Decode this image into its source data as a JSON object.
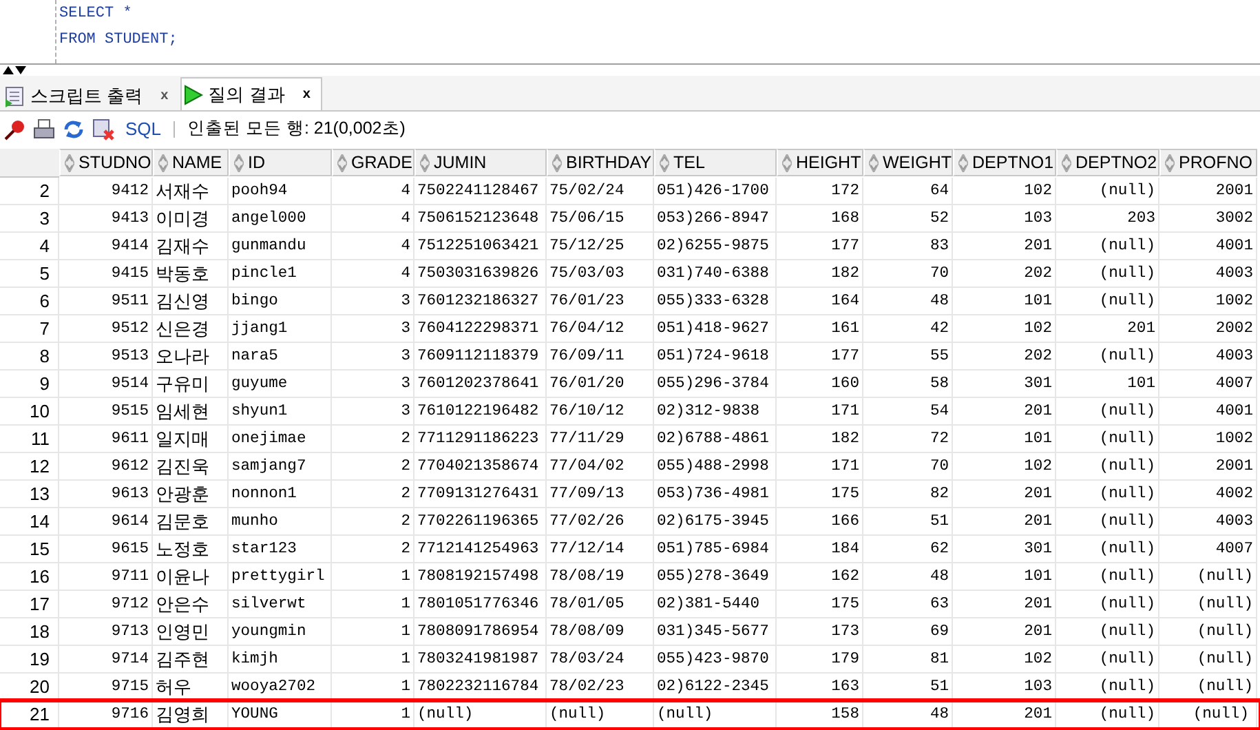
{
  "editor": {
    "lines": [
      "SELECT *",
      "FROM STUDENT;"
    ]
  },
  "tabs": [
    {
      "label": "스크립트 출력",
      "close": "x",
      "selected": false
    },
    {
      "label": "질의 결과",
      "close": "x",
      "selected": true
    }
  ],
  "toolbar": {
    "sql_link": "SQL",
    "status": "인출된 모든 행: 21(0,002초)"
  },
  "table": {
    "columns": [
      {
        "label": "STUDNO",
        "kind": "number"
      },
      {
        "label": "NAME",
        "kind": "hangul"
      },
      {
        "label": "ID",
        "kind": "text"
      },
      {
        "label": "GRADE",
        "kind": "number"
      },
      {
        "label": "JUMIN",
        "kind": "text"
      },
      {
        "label": "BIRTHDAY",
        "kind": "text"
      },
      {
        "label": "TEL",
        "kind": "text"
      },
      {
        "label": "HEIGHT",
        "kind": "number"
      },
      {
        "label": "WEIGHT",
        "kind": "number"
      },
      {
        "label": "DEPTNO1",
        "kind": "number"
      },
      {
        "label": "DEPTNO2",
        "kind": "number"
      },
      {
        "label": "PROFNO",
        "kind": "number"
      }
    ],
    "rows": [
      {
        "number": "2",
        "highlighted": false,
        "cells": [
          "9412",
          "서재수",
          "pooh94",
          "4",
          "7502241128467",
          "75/02/24",
          "051)426-1700",
          "172",
          "64",
          "102",
          "(null)",
          "2001"
        ]
      },
      {
        "number": "3",
        "highlighted": false,
        "cells": [
          "9413",
          "이미경",
          "angel000",
          "4",
          "7506152123648",
          "75/06/15",
          "053)266-8947",
          "168",
          "52",
          "103",
          "203",
          "3002"
        ]
      },
      {
        "number": "4",
        "highlighted": false,
        "cells": [
          "9414",
          "김재수",
          "gunmandu",
          "4",
          "7512251063421",
          "75/12/25",
          "02)6255-9875",
          "177",
          "83",
          "201",
          "(null)",
          "4001"
        ]
      },
      {
        "number": "5",
        "highlighted": false,
        "cells": [
          "9415",
          "박동호",
          "pincle1",
          "4",
          "7503031639826",
          "75/03/03",
          "031)740-6388",
          "182",
          "70",
          "202",
          "(null)",
          "4003"
        ]
      },
      {
        "number": "6",
        "highlighted": false,
        "cells": [
          "9511",
          "김신영",
          "bingo",
          "3",
          "7601232186327",
          "76/01/23",
          "055)333-6328",
          "164",
          "48",
          "101",
          "(null)",
          "1002"
        ]
      },
      {
        "number": "7",
        "highlighted": false,
        "cells": [
          "9512",
          "신은경",
          "jjang1",
          "3",
          "7604122298371",
          "76/04/12",
          "051)418-9627",
          "161",
          "42",
          "102",
          "201",
          "2002"
        ]
      },
      {
        "number": "8",
        "highlighted": false,
        "cells": [
          "9513",
          "오나라",
          "nara5",
          "3",
          "7609112118379",
          "76/09/11",
          "051)724-9618",
          "177",
          "55",
          "202",
          "(null)",
          "4003"
        ]
      },
      {
        "number": "9",
        "highlighted": false,
        "cells": [
          "9514",
          "구유미",
          "guyume",
          "3",
          "7601202378641",
          "76/01/20",
          "055)296-3784",
          "160",
          "58",
          "301",
          "101",
          "4007"
        ]
      },
      {
        "number": "10",
        "highlighted": false,
        "cells": [
          "9515",
          "임세현",
          "shyun1",
          "3",
          "7610122196482",
          "76/10/12",
          "02)312-9838",
          "171",
          "54",
          "201",
          "(null)",
          "4001"
        ]
      },
      {
        "number": "11",
        "highlighted": false,
        "cells": [
          "9611",
          "일지매",
          "onejimae",
          "2",
          "7711291186223",
          "77/11/29",
          "02)6788-4861",
          "182",
          "72",
          "101",
          "(null)",
          "1002"
        ]
      },
      {
        "number": "12",
        "highlighted": false,
        "cells": [
          "9612",
          "김진욱",
          "samjang7",
          "2",
          "7704021358674",
          "77/04/02",
          "055)488-2998",
          "171",
          "70",
          "102",
          "(null)",
          "2001"
        ]
      },
      {
        "number": "13",
        "highlighted": false,
        "cells": [
          "9613",
          "안광훈",
          "nonnon1",
          "2",
          "7709131276431",
          "77/09/13",
          "053)736-4981",
          "175",
          "82",
          "201",
          "(null)",
          "4002"
        ]
      },
      {
        "number": "14",
        "highlighted": false,
        "cells": [
          "9614",
          "김문호",
          "munho",
          "2",
          "7702261196365",
          "77/02/26",
          "02)6175-3945",
          "166",
          "51",
          "201",
          "(null)",
          "4003"
        ]
      },
      {
        "number": "15",
        "highlighted": false,
        "cells": [
          "9615",
          "노정호",
          "star123",
          "2",
          "7712141254963",
          "77/12/14",
          "051)785-6984",
          "184",
          "62",
          "301",
          "(null)",
          "4007"
        ]
      },
      {
        "number": "16",
        "highlighted": false,
        "cells": [
          "9711",
          "이윤나",
          "prettygirl",
          "1",
          "7808192157498",
          "78/08/19",
          "055)278-3649",
          "162",
          "48",
          "101",
          "(null)",
          "(null)"
        ]
      },
      {
        "number": "17",
        "highlighted": false,
        "cells": [
          "9712",
          "안은수",
          "silverwt",
          "1",
          "7801051776346",
          "78/01/05",
          "02)381-5440",
          "175",
          "63",
          "201",
          "(null)",
          "(null)"
        ]
      },
      {
        "number": "18",
        "highlighted": false,
        "cells": [
          "9713",
          "인영민",
          "youngmin",
          "1",
          "7808091786954",
          "78/08/09",
          "031)345-5677",
          "173",
          "69",
          "201",
          "(null)",
          "(null)"
        ]
      },
      {
        "number": "19",
        "highlighted": false,
        "cells": [
          "9714",
          "김주현",
          "kimjh",
          "1",
          "7803241981987",
          "78/03/24",
          "055)423-9870",
          "179",
          "81",
          "102",
          "(null)",
          "(null)"
        ]
      },
      {
        "number": "20",
        "highlighted": false,
        "cells": [
          "9715",
          "허우",
          "wooya2702",
          "1",
          "7802232116784",
          "78/02/23",
          "02)6122-2345",
          "163",
          "51",
          "103",
          "(null)",
          "(null)"
        ]
      },
      {
        "number": "21",
        "highlighted": true,
        "cells": [
          "9716",
          "김영희",
          "YOUNG",
          "1",
          "(null)",
          "(null)",
          "(null)",
          "158",
          "48",
          "201",
          "(null)",
          "(null)"
        ]
      }
    ]
  }
}
